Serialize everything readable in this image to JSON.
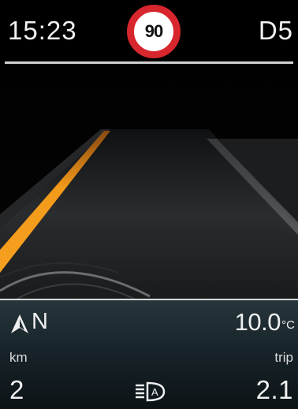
{
  "status_bar": {
    "time": "15:23",
    "speed_limit": "90",
    "gear": "D5"
  },
  "info_panel": {
    "heading": "N",
    "temperature": "10.0",
    "temperature_unit": "°C",
    "distance_unit": "km",
    "distance_value": "2",
    "trip_label": "trip",
    "trip_value": "2.1"
  },
  "icons": {
    "compass": "compass-arrow-icon",
    "lights": "auto-headlight-icon"
  },
  "colors": {
    "lane_marking": "#f39a1a",
    "speed_sign_ring": "#d7262d",
    "panel_bg": "#1c2a30"
  }
}
